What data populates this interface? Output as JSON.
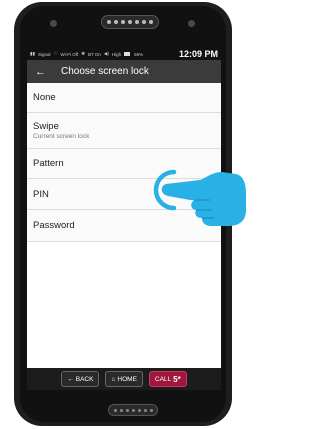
{
  "status_bar": {
    "signal": "Signal",
    "wifi": "Wi-Fi Off",
    "bluetooth": "BT On",
    "sound": "High",
    "battery": "55%",
    "time": "12:09 PM"
  },
  "app_bar": {
    "back_icon": "arrow-left-icon",
    "title": "Choose screen lock"
  },
  "options": [
    {
      "label": "None"
    },
    {
      "label": "Swipe",
      "sublabel": "Current screen lock"
    },
    {
      "label": "Pattern"
    },
    {
      "label": "PIN"
    },
    {
      "label": "Password"
    }
  ],
  "nav": {
    "back_label": "BACK",
    "home_label": "HOME",
    "call_label": "CALL",
    "call_key": "5*"
  },
  "colors": {
    "app_bar": "#3b3b3b",
    "call_button": "#a0173e",
    "hand": "#29b1e6"
  },
  "overlay": {
    "icon": "pointing-hand-icon"
  }
}
